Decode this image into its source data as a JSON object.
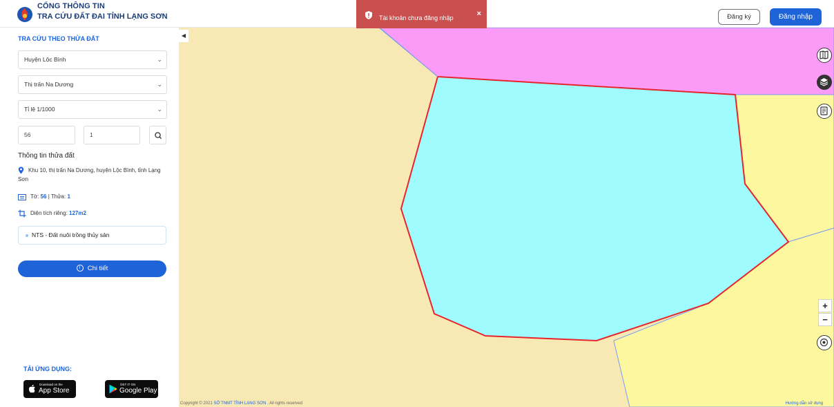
{
  "header": {
    "brand_line1": "CỔNG THÔNG TIN",
    "brand_line2": "TRA CỨU ĐẤT ĐAI TỈNH LẠNG SƠN",
    "register_label": "Đăng ký",
    "login_label": "Đăng nhập"
  },
  "toast": {
    "message": "Tài khoản chưa đăng nhập",
    "close": "×"
  },
  "sidebar": {
    "title": "TRA CỨU THEO THỬA ĐẤT",
    "district": "Huyện Lộc Bình",
    "commune": "Thị trấn Na Dương",
    "scale": "Tỉ lệ 1/1000",
    "sheet_no": "56",
    "parcel_no": "1",
    "info_title": "Thông tin thửa đất",
    "address": "Khu 10, thị trấn Na Dương, huyện Lộc Bình, tỉnh Lạng Sơn",
    "sheet_label": "Tờ: ",
    "sheet_value": "56",
    "parcel_sep": " | Thửa: ",
    "parcel_value": "1",
    "area_label": "Diện tích riêng: ",
    "area_value": "127m2",
    "land_use": "NTS - Đất nuôi trồng thủy sản",
    "detail_button": "Chi tiết",
    "app_title": "TẢI ỨNG DỤNG:",
    "appstore_small": "Download on the",
    "appstore_big": "App Store",
    "googleplay_small": "GET IT ON",
    "googleplay_big": "Google Play"
  },
  "map": {
    "colors": {
      "base": "#f8e8b4",
      "pink": "#fa9bf8",
      "yellow": "#fdf8a0",
      "parcel": "#a0fbfe",
      "outline": "#e8242b"
    },
    "zoom_in": "+",
    "zoom_out": "−",
    "icons": [
      "map-book-icon",
      "layers-icon",
      "note-icon",
      "locate-icon"
    ]
  },
  "footer": {
    "copyright_prefix": "Copyright © 2021 ",
    "copyright_org": "SỞ TNMT TỈNH LẠNG SƠN",
    "copyright_suffix": " . All rights reserved",
    "guide": "Hướng dẫn sử dụng"
  }
}
